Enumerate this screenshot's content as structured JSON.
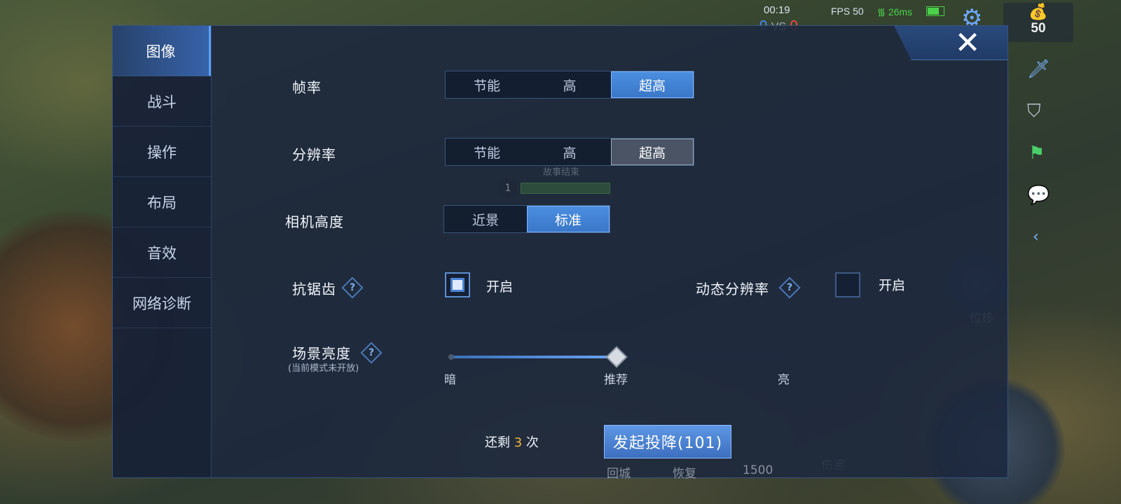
{
  "hud": {
    "timer": "00:19",
    "fps": "FPS 50",
    "ping": "26ms",
    "score_blue": "0",
    "vs": "VS",
    "score_red": "0",
    "gold": "50"
  },
  "colors": {
    "panel_bg": "#1c283e",
    "accent_blue": "#3a77c8",
    "highlight": "#f0b53a"
  },
  "sidebar": {
    "items": [
      {
        "label": "图像",
        "active": true
      },
      {
        "label": "战斗",
        "active": false
      },
      {
        "label": "操作",
        "active": false
      },
      {
        "label": "布局",
        "active": false
      },
      {
        "label": "音效",
        "active": false
      },
      {
        "label": "网络诊断",
        "active": false
      }
    ]
  },
  "close_label": "✕",
  "settings": {
    "frame_rate": {
      "label": "帧率",
      "options": [
        "节能",
        "高",
        "超高"
      ],
      "selected": "超高"
    },
    "resolution": {
      "label": "分辨率",
      "options": [
        "节能",
        "高",
        "超高"
      ],
      "selected": "超高"
    },
    "camera_height": {
      "label": "相机高度",
      "options": [
        "近景",
        "标准"
      ],
      "selected": "标准"
    },
    "antialiasing": {
      "label": "抗锯齿",
      "help": "?",
      "checkbox_label": "开启",
      "checked": true
    },
    "dynamic_resolution": {
      "label": "动态分辨率",
      "help": "?",
      "checkbox_label": "开启",
      "checked": false
    },
    "brightness": {
      "label": "场景亮度",
      "help": "?",
      "note": "(当前模式未开放)",
      "min_label": "暗",
      "mid_label": "推荐",
      "max_label": "亮",
      "value": 0.5
    }
  },
  "footer": {
    "remain_prefix": "还剩",
    "remain_count": "3",
    "remain_suffix": "次",
    "surrender_label": "发起投降(101)"
  },
  "background_hud": {
    "story_end": "故事结束",
    "level": "1",
    "skill_displace": "位移",
    "skill_return": "回城",
    "skill_restore": "恢复",
    "skill_damage": "伤害",
    "gold_spent": "1500",
    "kills": "0"
  }
}
